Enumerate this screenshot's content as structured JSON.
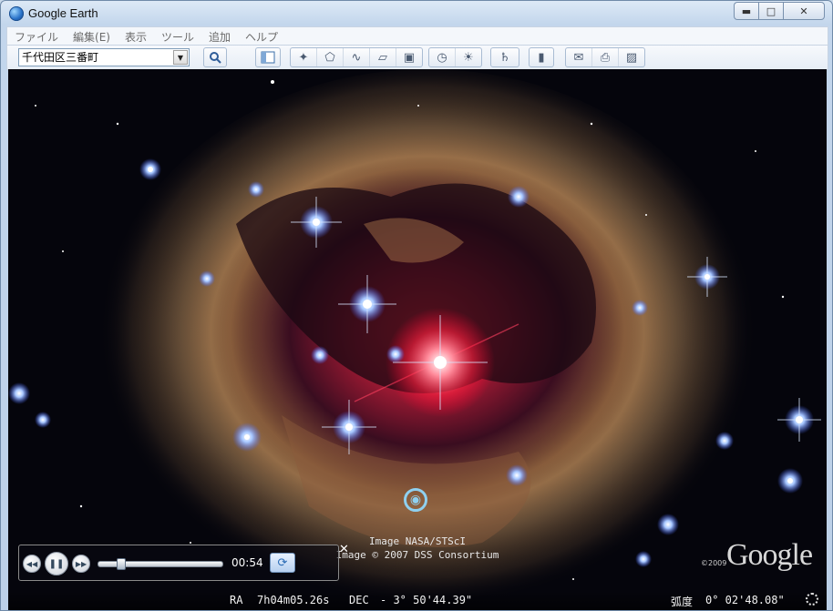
{
  "window": {
    "title": "Google Earth"
  },
  "window_controls": {
    "minimize": "▬",
    "maximize": "□",
    "close": "✕"
  },
  "menu": {
    "items": [
      "ファイル",
      "編集(E)",
      "表示",
      "ツール",
      "追加",
      "ヘルプ"
    ]
  },
  "search": {
    "value": "千代田区三番町",
    "dropdown_icon": "▼"
  },
  "toolbar_icons": {
    "search": "search-icon",
    "sidebar": "sidebar-toggle-icon",
    "placemark": "add-placemark-icon",
    "polygon": "add-polygon-icon",
    "path": "add-path-icon",
    "overlay": "add-image-overlay-icon",
    "tour": "record-tour-icon",
    "history": "historical-imagery-icon",
    "sun": "sunlight-icon",
    "planets": "planets-icon",
    "ruler": "ruler-icon",
    "email": "email-icon",
    "print": "print-icon",
    "save_image": "save-image-icon"
  },
  "view": {
    "credits": [
      "Image NASA/STScI",
      "Image © 2007 DSS Consortium"
    ],
    "google_logo": "Google",
    "copyright_year": "©2009"
  },
  "tour": {
    "time": "00:54",
    "progress": 0.18
  },
  "status": {
    "ra_label": "RA",
    "ra_value": "7h04m05.26s",
    "dec_label": "DEC",
    "dec_value": "- 3° 50'44.39\"",
    "arc_label": "弧度",
    "arc_value": "0° 02'48.08\""
  },
  "colors": {
    "sky": "#05050c",
    "nebula_core": "#ff3048",
    "star": "#bcd6ff",
    "title_bar": "#c3d6ec"
  }
}
